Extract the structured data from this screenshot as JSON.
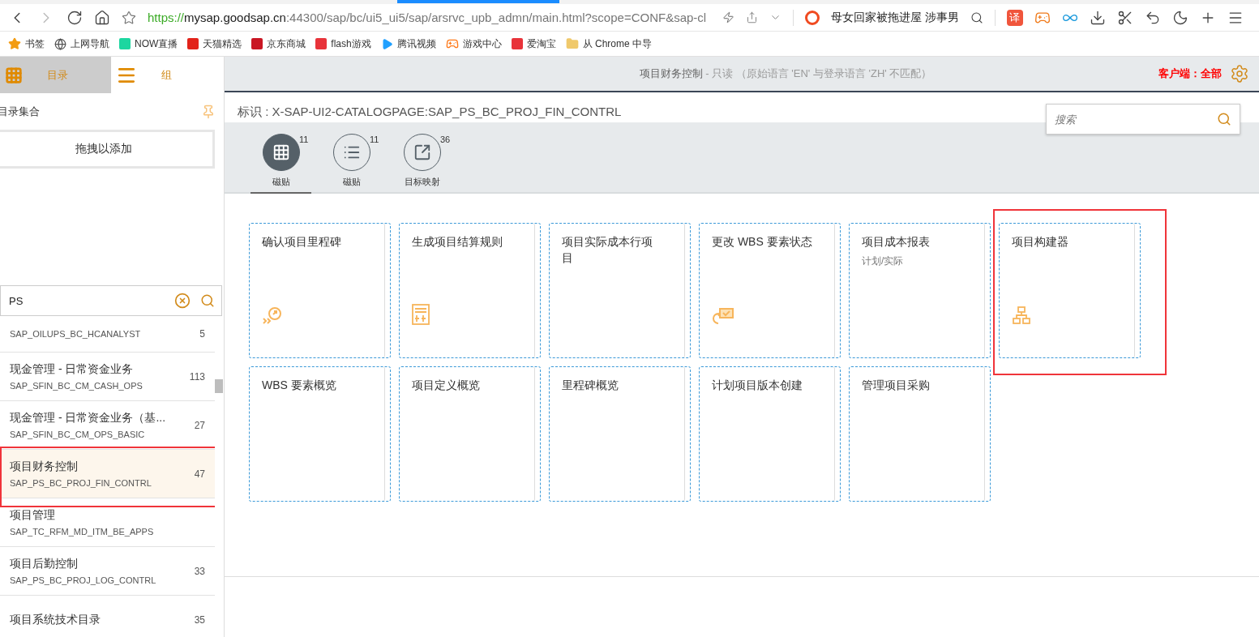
{
  "browser": {
    "url": {
      "scheme": "https://",
      "host": "mysap.goodsap.cn",
      "rest": ":44300/sap/bc/ui5_ui5/sap/arsrvc_upb_admn/main.html?scope=CONF&sap-cl"
    },
    "news": "母女回家被拖进屋 涉事男",
    "translate_glyph": "译",
    "bookmarks": [
      {
        "label": "书签",
        "kind": "star",
        "color": "#f39c12"
      },
      {
        "label": "上网导航",
        "kind": "globe",
        "color": "#555555"
      },
      {
        "label": "NOW直播",
        "kind": "tile",
        "color": "#1dd6a0"
      },
      {
        "label": "天猫精选",
        "kind": "tile",
        "color": "#e2231a"
      },
      {
        "label": "京东商城",
        "kind": "tile",
        "color": "#c91623"
      },
      {
        "label": "flash游戏",
        "kind": "tile",
        "color": "#e8333a"
      },
      {
        "label": "腾讯视频",
        "kind": "play",
        "color": "#20a0ff"
      },
      {
        "label": "游戏中心",
        "kind": "game",
        "color": "#ff7a1a"
      },
      {
        "label": "爱淘宝",
        "kind": "tile",
        "color": "#e8333a"
      },
      {
        "label": "从 Chrome 中导",
        "kind": "folder",
        "color": "#f0c96b"
      }
    ]
  },
  "sidebar": {
    "tabs": [
      {
        "label": "目录",
        "kind": "grid",
        "selected": true
      },
      {
        "label": "组",
        "kind": "lines",
        "selected": false
      }
    ],
    "section_title": "目录集合",
    "drop_button": "拖拽以添加",
    "search": {
      "value": "PS"
    },
    "catalogs": [
      {
        "code": "SAP_OILUPS_BC_HCANALYST",
        "count": "5",
        "selected": false,
        "highlighted": false
      },
      {
        "title": "现金管理 - 日常资金业务",
        "code": "SAP_SFIN_BC_CM_CASH_OPS",
        "count": "113",
        "selected": false,
        "highlighted": false
      },
      {
        "title": "现金管理 - 日常资金业务（基...",
        "code": "SAP_SFIN_BC_CM_OPS_BASIC",
        "count": "27",
        "selected": false,
        "highlighted": false
      },
      {
        "title": "项目财务控制",
        "code": "SAP_PS_BC_PROJ_FIN_CONTRL",
        "count": "47",
        "selected": true,
        "highlighted": true
      },
      {
        "title": "项目管理",
        "code": "SAP_TC_RFM_MD_ITM_BE_APPS",
        "selected": false,
        "highlighted": false
      },
      {
        "title": "项目后勤控制",
        "code": "SAP_PS_BC_PROJ_LOG_CONTRL",
        "count": "33",
        "selected": false,
        "highlighted": false
      },
      {
        "title": "项目系统技术目录",
        "count": "35",
        "selected": false,
        "highlighted": false
      }
    ]
  },
  "header": {
    "title": "项目财务控制",
    "suffix": " - 只读 （原始语言 'EN' 与登录语言 'ZH' 不匹配）",
    "client": "客户端：全部"
  },
  "page": {
    "id_label": "标识 : X-SAP-UI2-CATALOGPAGE:SAP_PS_BC_PROJ_FIN_CONTRL",
    "search": {
      "placeholder": "搜索"
    },
    "view_tabs": [
      {
        "label": "磁贴",
        "count": "11",
        "kind": "grid",
        "selected": true
      },
      {
        "label": "磁贴",
        "count": "11",
        "kind": "list",
        "selected": false
      },
      {
        "label": "目标映射",
        "count": "36",
        "kind": "share",
        "selected": false
      }
    ],
    "tiles": [
      {
        "title": "确认项目里程碑",
        "kind": "milestone",
        "highlighted": false
      },
      {
        "title": "生成项目结算规则",
        "kind": "billing",
        "highlighted": false
      },
      {
        "title": "项目实际成本行项目",
        "highlighted": false
      },
      {
        "title": "更改 WBS 要素状态",
        "kind": "status",
        "highlighted": false
      },
      {
        "title": "项目成本报表",
        "subtitle": "计划/实际",
        "highlighted": false
      },
      {
        "title": "项目构建器",
        "kind": "hierarchy",
        "highlighted": true
      },
      {
        "title": "WBS 要素概览",
        "highlighted": false
      },
      {
        "title": "项目定义概览",
        "highlighted": false
      },
      {
        "title": "里程碑概览",
        "highlighted": false
      },
      {
        "title": "计划项目版本创建",
        "highlighted": false
      },
      {
        "title": "管理项目采购",
        "highlighted": false
      }
    ]
  }
}
